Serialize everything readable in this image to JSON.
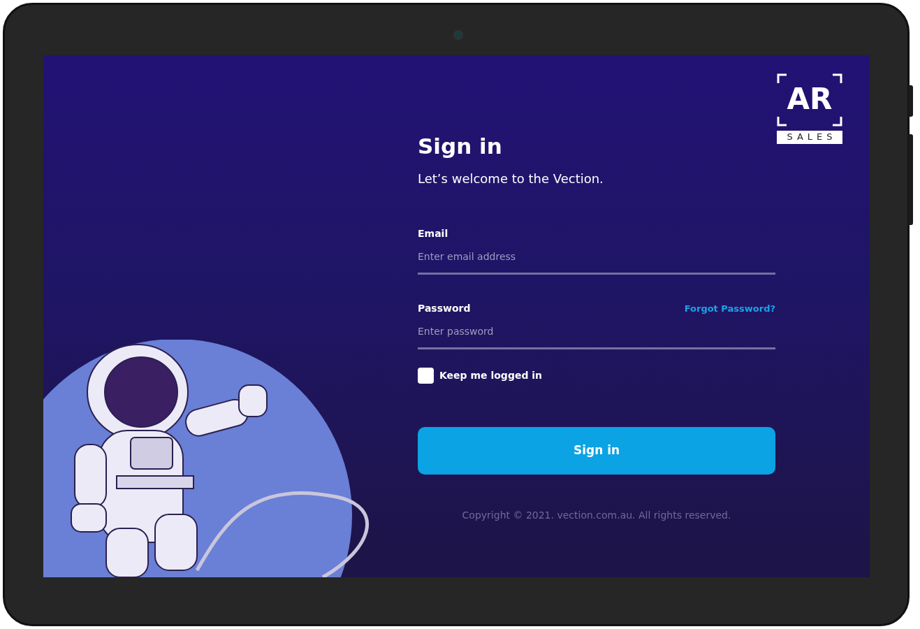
{
  "logo": {
    "text": "AR",
    "subtitle": "SALES"
  },
  "title": "Sign in",
  "subtitle": "Let’s welcome to the Vection.",
  "fields": [
    {
      "kind": "email",
      "label": "Email",
      "placeholder": "Enter email address"
    },
    {
      "kind": "password",
      "label": "Password",
      "placeholder": "Enter password",
      "link": "Forgot Password?"
    }
  ],
  "remember": {
    "label": "Keep me logged in",
    "checked": false
  },
  "button": "Sign in",
  "copyright": "Copyright © 2021. vection.com.au. All rights reserved."
}
